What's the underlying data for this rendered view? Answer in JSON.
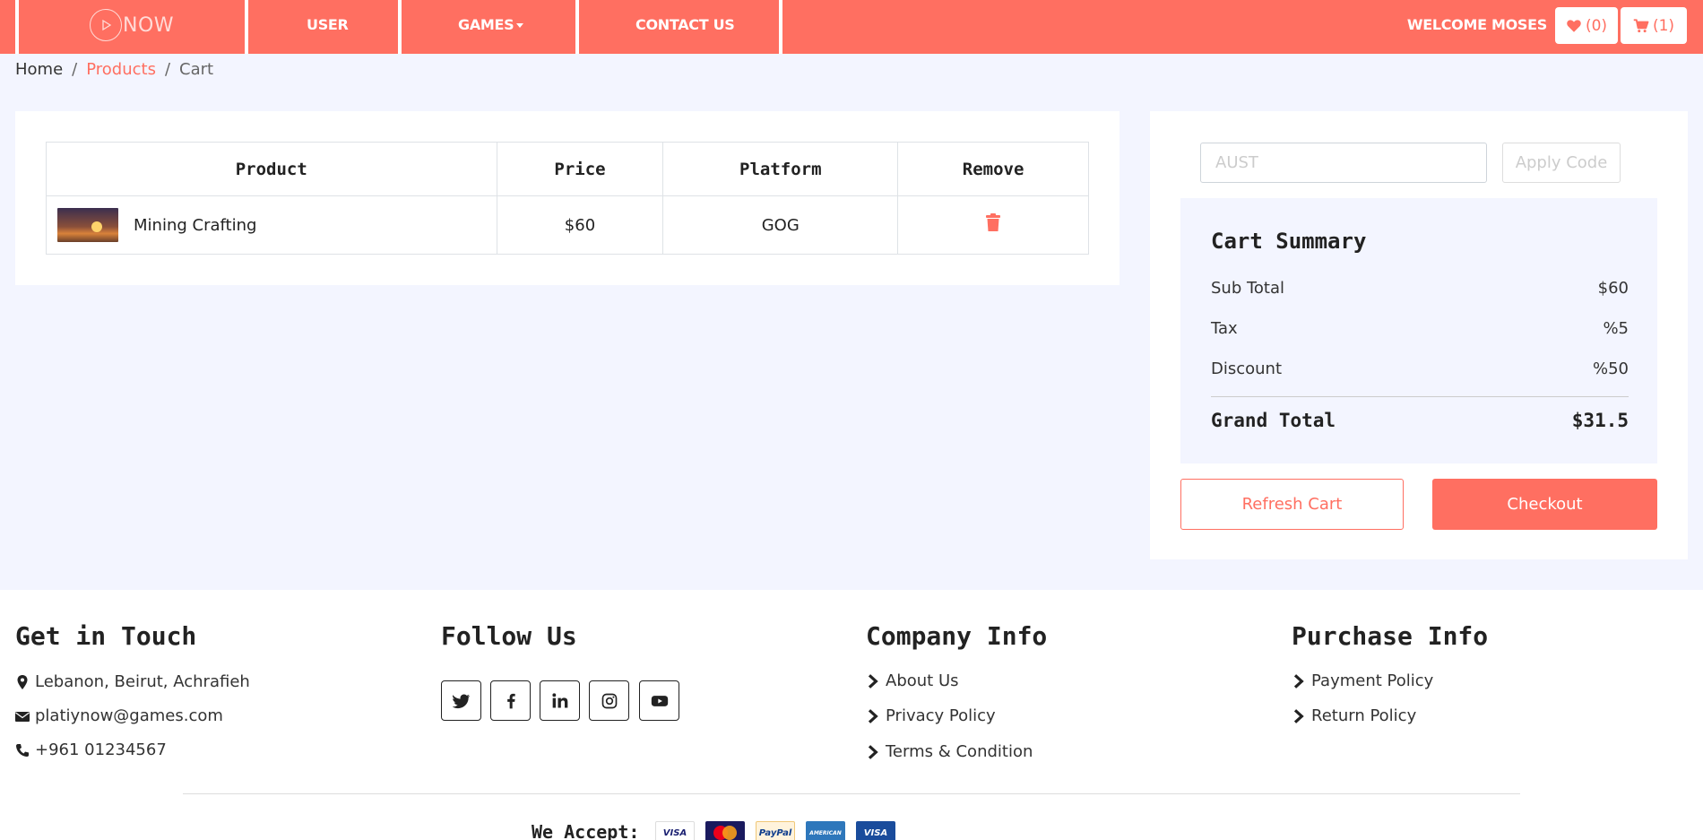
{
  "colors": {
    "accent": "#ff6f61",
    "page_bg": "#f3f5ff",
    "text": "#222222"
  },
  "nav": {
    "logo_text": "NOW",
    "links": [
      "USER",
      "GAMES",
      "CONTACT US"
    ],
    "welcome": "WELCOME MOSES",
    "wishlist_count": "(0)",
    "cart_count": "(1)"
  },
  "breadcrumb": {
    "home": "Home",
    "products": "Products",
    "current": "Cart"
  },
  "cart_table": {
    "headers": [
      "Product",
      "Price",
      "Platform",
      "Remove"
    ],
    "rows": [
      {
        "product": "Mining Crafting",
        "price": "$60",
        "platform": "GOG"
      }
    ]
  },
  "coupon": {
    "value": "AUST",
    "apply_label": "Apply Code"
  },
  "summary": {
    "title": "Cart Summary",
    "sub_total_label": "Sub Total",
    "sub_total": "$60",
    "tax_label": "Tax",
    "tax": "%5",
    "discount_label": "Discount",
    "discount": "%50",
    "grand_total_label": "Grand Total",
    "grand_total": "$31.5"
  },
  "actions": {
    "refresh": "Refresh Cart",
    "checkout": "Checkout"
  },
  "footer": {
    "get_in_touch": {
      "title": "Get in Touch",
      "address": "Lebanon, Beirut, Achrafieh",
      "email": "platiynow@games.com",
      "phone": "+961 01234567"
    },
    "follow_us": {
      "title": "Follow Us",
      "icons": [
        "twitter-icon",
        "facebook-icon",
        "linkedin-icon",
        "instagram-icon",
        "youtube-icon"
      ]
    },
    "company_info": {
      "title": "Company Info",
      "links": [
        "About Us",
        "Privacy Policy",
        "Terms & Condition"
      ]
    },
    "purchase_info": {
      "title": "Purchase Info",
      "links": [
        "Payment Policy",
        "Return Policy"
      ]
    },
    "we_accept": "We Accept:",
    "cards": [
      "VISA",
      "MasterCard",
      "PayPal",
      "AMERICAN EXPRESS",
      "VISA Electron"
    ]
  }
}
